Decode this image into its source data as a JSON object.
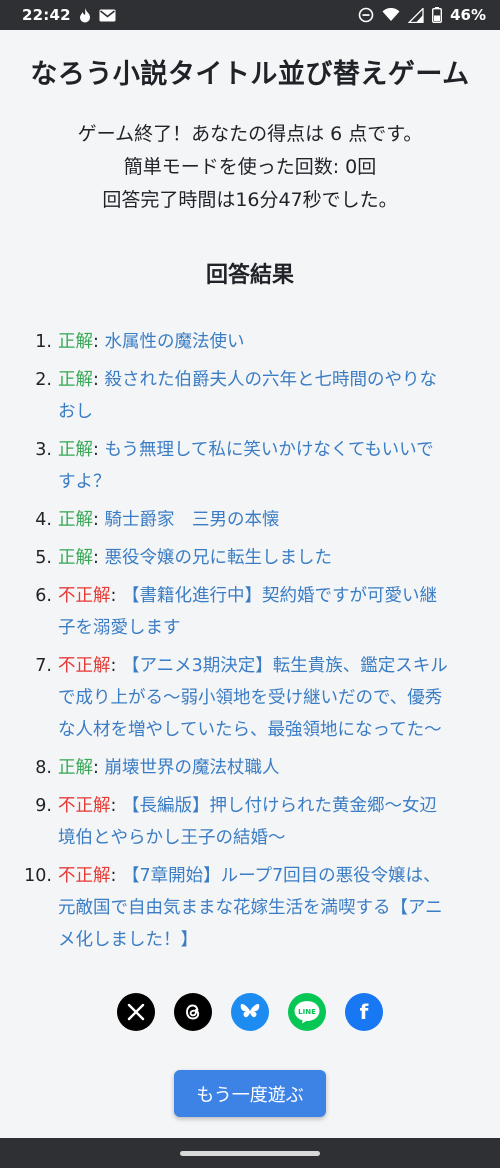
{
  "status_bar": {
    "time": "22:42",
    "battery": "46%",
    "icons": [
      "flame-icon",
      "mail-icon",
      "do-not-disturb-icon",
      "wifi-icon",
      "signal-icon",
      "battery-icon"
    ]
  },
  "page": {
    "title": "なろう小説タイトル並び替えゲーム",
    "summary": {
      "score_line": "ゲーム終了！あなたの得点は 6 点です。",
      "easy_mode_line": "簡単モードを使った回数: 0回",
      "time_line": "回答完了時間は16分47秒でした。"
    },
    "results_heading": "回答結果",
    "results": [
      {
        "number": "1.",
        "verdict": "正解",
        "correct": true,
        "title": "水属性の魔法使い"
      },
      {
        "number": "2.",
        "verdict": "正解",
        "correct": true,
        "title": "殺された伯爵夫人の六年と七時間のやりなおし"
      },
      {
        "number": "3.",
        "verdict": "正解",
        "correct": true,
        "title": "もう無理して私に笑いかけなくてもいいですよ？"
      },
      {
        "number": "4.",
        "verdict": "正解",
        "correct": true,
        "title": "騎士爵家　三男の本懐"
      },
      {
        "number": "5.",
        "verdict": "正解",
        "correct": true,
        "title": "悪役令嬢の兄に転生しました"
      },
      {
        "number": "6.",
        "verdict": "不正解",
        "correct": false,
        "title": "【書籍化進行中】契約婚ですが可愛い継子を溺愛します"
      },
      {
        "number": "7.",
        "verdict": "不正解",
        "correct": false,
        "title": "【アニメ3期決定】転生貴族、鑑定スキルで成り上がる～弱小領地を受け継いだので、優秀な人材を増やしていたら、最強領地になってた～"
      },
      {
        "number": "8.",
        "verdict": "正解",
        "correct": true,
        "title": "崩壊世界の魔法杖職人"
      },
      {
        "number": "9.",
        "verdict": "不正解",
        "correct": false,
        "title": "【長編版】押し付けられた黄金郷～女辺境伯とやらかし王子の結婚～"
      },
      {
        "number": "10.",
        "verdict": "不正解",
        "correct": false,
        "title": "【7章開始】ループ7回目の悪役令嬢は、元敵国で自由気ままな花嫁生活を満喫する【アニメ化しました！】"
      }
    ],
    "share": [
      {
        "name": "x",
        "icon": "x-logo-icon"
      },
      {
        "name": "threads",
        "icon": "threads-logo-icon"
      },
      {
        "name": "bluesky",
        "icon": "bluesky-butterfly-icon"
      },
      {
        "name": "line",
        "icon": "line-logo-icon",
        "glyph": "LINE"
      },
      {
        "name": "facebook",
        "icon": "facebook-logo-icon",
        "glyph": "f"
      }
    ],
    "replay_label": "もう一度遊ぶ"
  },
  "colors": {
    "correct": "#34a853",
    "wrong": "#e53935",
    "title_link": "#3b7dc4",
    "button": "#3d82e5"
  }
}
